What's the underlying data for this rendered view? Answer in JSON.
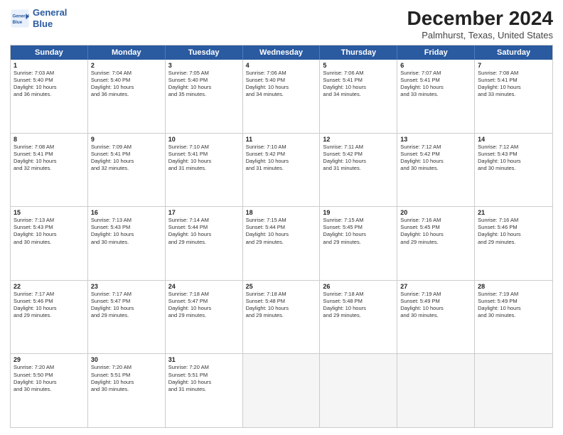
{
  "header": {
    "logo_line1": "General",
    "logo_line2": "Blue",
    "month": "December 2024",
    "location": "Palmhurst, Texas, United States"
  },
  "weekdays": [
    "Sunday",
    "Monday",
    "Tuesday",
    "Wednesday",
    "Thursday",
    "Friday",
    "Saturday"
  ],
  "rows": [
    [
      {
        "day": "1",
        "lines": [
          "Sunrise: 7:03 AM",
          "Sunset: 5:40 PM",
          "Daylight: 10 hours",
          "and 36 minutes."
        ]
      },
      {
        "day": "2",
        "lines": [
          "Sunrise: 7:04 AM",
          "Sunset: 5:40 PM",
          "Daylight: 10 hours",
          "and 36 minutes."
        ]
      },
      {
        "day": "3",
        "lines": [
          "Sunrise: 7:05 AM",
          "Sunset: 5:40 PM",
          "Daylight: 10 hours",
          "and 35 minutes."
        ]
      },
      {
        "day": "4",
        "lines": [
          "Sunrise: 7:06 AM",
          "Sunset: 5:40 PM",
          "Daylight: 10 hours",
          "and 34 minutes."
        ]
      },
      {
        "day": "5",
        "lines": [
          "Sunrise: 7:06 AM",
          "Sunset: 5:41 PM",
          "Daylight: 10 hours",
          "and 34 minutes."
        ]
      },
      {
        "day": "6",
        "lines": [
          "Sunrise: 7:07 AM",
          "Sunset: 5:41 PM",
          "Daylight: 10 hours",
          "and 33 minutes."
        ]
      },
      {
        "day": "7",
        "lines": [
          "Sunrise: 7:08 AM",
          "Sunset: 5:41 PM",
          "Daylight: 10 hours",
          "and 33 minutes."
        ]
      }
    ],
    [
      {
        "day": "8",
        "lines": [
          "Sunrise: 7:08 AM",
          "Sunset: 5:41 PM",
          "Daylight: 10 hours",
          "and 32 minutes."
        ]
      },
      {
        "day": "9",
        "lines": [
          "Sunrise: 7:09 AM",
          "Sunset: 5:41 PM",
          "Daylight: 10 hours",
          "and 32 minutes."
        ]
      },
      {
        "day": "10",
        "lines": [
          "Sunrise: 7:10 AM",
          "Sunset: 5:41 PM",
          "Daylight: 10 hours",
          "and 31 minutes."
        ]
      },
      {
        "day": "11",
        "lines": [
          "Sunrise: 7:10 AM",
          "Sunset: 5:42 PM",
          "Daylight: 10 hours",
          "and 31 minutes."
        ]
      },
      {
        "day": "12",
        "lines": [
          "Sunrise: 7:11 AM",
          "Sunset: 5:42 PM",
          "Daylight: 10 hours",
          "and 31 minutes."
        ]
      },
      {
        "day": "13",
        "lines": [
          "Sunrise: 7:12 AM",
          "Sunset: 5:42 PM",
          "Daylight: 10 hours",
          "and 30 minutes."
        ]
      },
      {
        "day": "14",
        "lines": [
          "Sunrise: 7:12 AM",
          "Sunset: 5:43 PM",
          "Daylight: 10 hours",
          "and 30 minutes."
        ]
      }
    ],
    [
      {
        "day": "15",
        "lines": [
          "Sunrise: 7:13 AM",
          "Sunset: 5:43 PM",
          "Daylight: 10 hours",
          "and 30 minutes."
        ]
      },
      {
        "day": "16",
        "lines": [
          "Sunrise: 7:13 AM",
          "Sunset: 5:43 PM",
          "Daylight: 10 hours",
          "and 30 minutes."
        ]
      },
      {
        "day": "17",
        "lines": [
          "Sunrise: 7:14 AM",
          "Sunset: 5:44 PM",
          "Daylight: 10 hours",
          "and 29 minutes."
        ]
      },
      {
        "day": "18",
        "lines": [
          "Sunrise: 7:15 AM",
          "Sunset: 5:44 PM",
          "Daylight: 10 hours",
          "and 29 minutes."
        ]
      },
      {
        "day": "19",
        "lines": [
          "Sunrise: 7:15 AM",
          "Sunset: 5:45 PM",
          "Daylight: 10 hours",
          "and 29 minutes."
        ]
      },
      {
        "day": "20",
        "lines": [
          "Sunrise: 7:16 AM",
          "Sunset: 5:45 PM",
          "Daylight: 10 hours",
          "and 29 minutes."
        ]
      },
      {
        "day": "21",
        "lines": [
          "Sunrise: 7:16 AM",
          "Sunset: 5:46 PM",
          "Daylight: 10 hours",
          "and 29 minutes."
        ]
      }
    ],
    [
      {
        "day": "22",
        "lines": [
          "Sunrise: 7:17 AM",
          "Sunset: 5:46 PM",
          "Daylight: 10 hours",
          "and 29 minutes."
        ]
      },
      {
        "day": "23",
        "lines": [
          "Sunrise: 7:17 AM",
          "Sunset: 5:47 PM",
          "Daylight: 10 hours",
          "and 29 minutes."
        ]
      },
      {
        "day": "24",
        "lines": [
          "Sunrise: 7:18 AM",
          "Sunset: 5:47 PM",
          "Daylight: 10 hours",
          "and 29 minutes."
        ]
      },
      {
        "day": "25",
        "lines": [
          "Sunrise: 7:18 AM",
          "Sunset: 5:48 PM",
          "Daylight: 10 hours",
          "and 29 minutes."
        ]
      },
      {
        "day": "26",
        "lines": [
          "Sunrise: 7:18 AM",
          "Sunset: 5:48 PM",
          "Daylight: 10 hours",
          "and 29 minutes."
        ]
      },
      {
        "day": "27",
        "lines": [
          "Sunrise: 7:19 AM",
          "Sunset: 5:49 PM",
          "Daylight: 10 hours",
          "and 30 minutes."
        ]
      },
      {
        "day": "28",
        "lines": [
          "Sunrise: 7:19 AM",
          "Sunset: 5:49 PM",
          "Daylight: 10 hours",
          "and 30 minutes."
        ]
      }
    ],
    [
      {
        "day": "29",
        "lines": [
          "Sunrise: 7:20 AM",
          "Sunset: 5:50 PM",
          "Daylight: 10 hours",
          "and 30 minutes."
        ]
      },
      {
        "day": "30",
        "lines": [
          "Sunrise: 7:20 AM",
          "Sunset: 5:51 PM",
          "Daylight: 10 hours",
          "and 30 minutes."
        ]
      },
      {
        "day": "31",
        "lines": [
          "Sunrise: 7:20 AM",
          "Sunset: 5:51 PM",
          "Daylight: 10 hours",
          "and 31 minutes."
        ]
      },
      null,
      null,
      null,
      null
    ]
  ]
}
